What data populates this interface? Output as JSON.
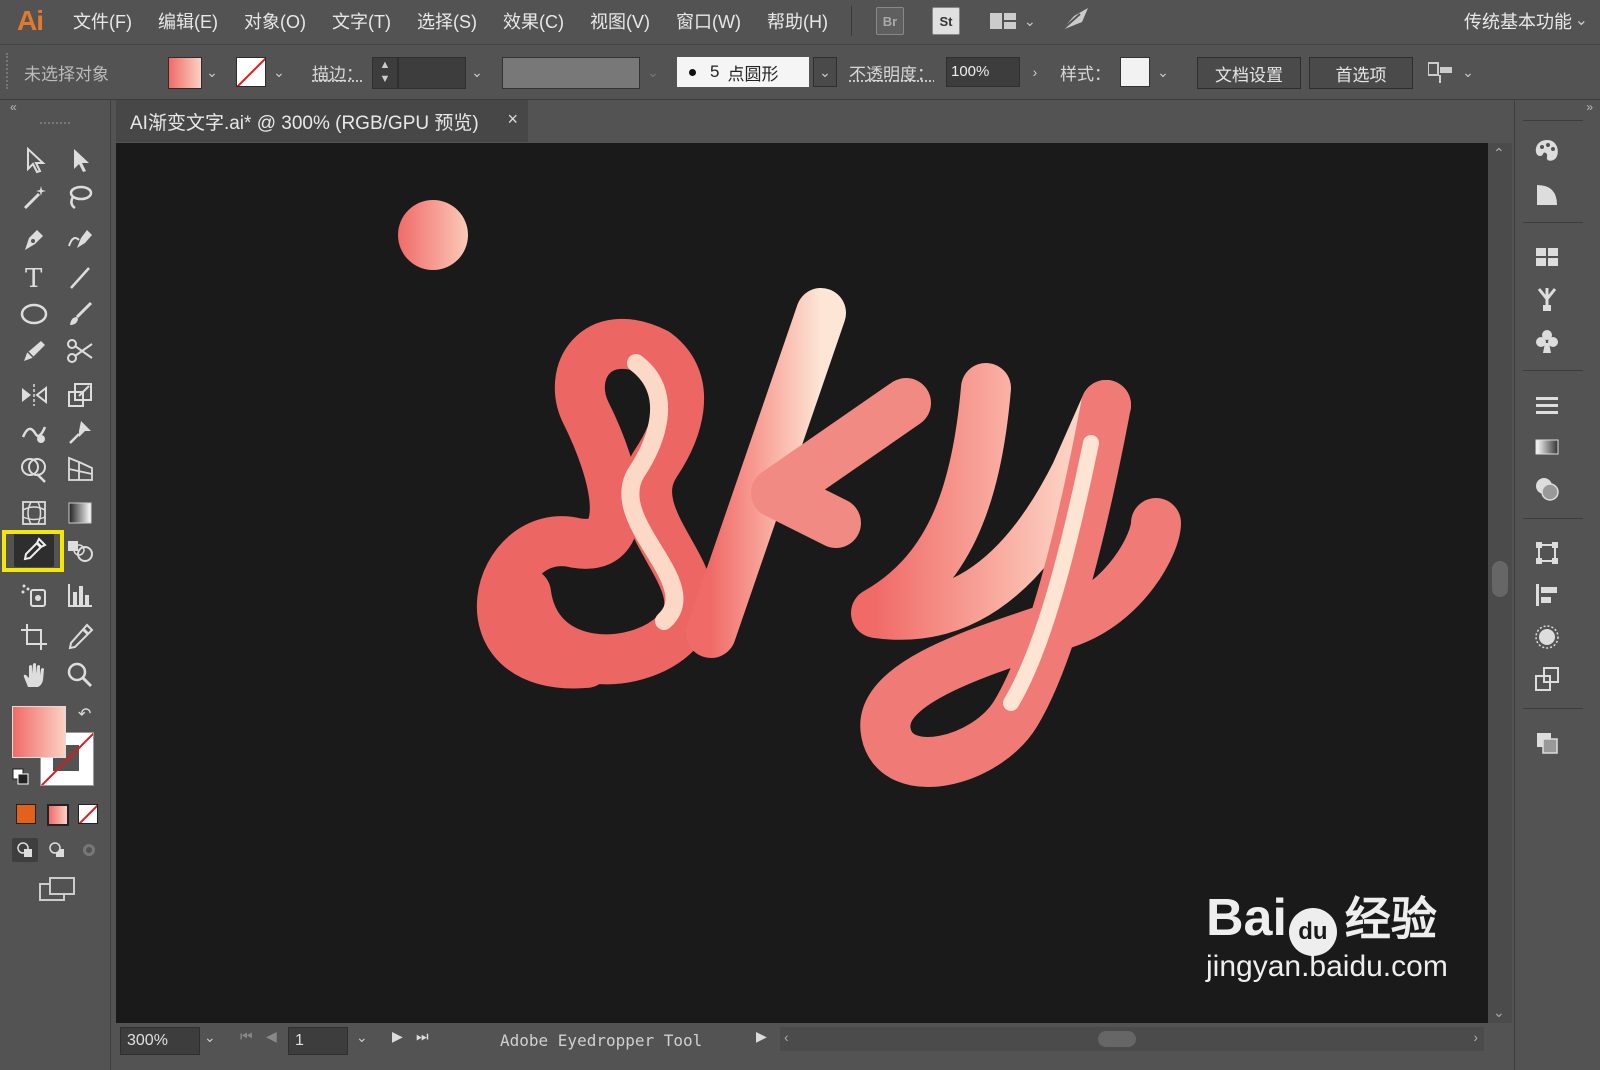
{
  "app": {
    "logo": "Ai",
    "workspace_label": "传统基本功能"
  },
  "menu": {
    "items": [
      "文件(F)",
      "编辑(E)",
      "对象(O)",
      "文字(T)",
      "选择(S)",
      "效果(C)",
      "视图(V)",
      "窗口(W)",
      "帮助(H)"
    ],
    "bridge_label": "Br",
    "stock_label": "St"
  },
  "control_bar": {
    "selection_status": "未选择对象",
    "stroke_label": "描边：",
    "brush_size": "5",
    "brush_name": "点圆形",
    "opacity_label": "不透明度：",
    "opacity_value": "100%",
    "style_label": "样式：",
    "doc_setup_button": "文档设置",
    "preferences_button": "首选项"
  },
  "document": {
    "tab_title": "AI渐变文字.ai* @ 300% (RGB/GPU 预览)",
    "tab_close": "×"
  },
  "artwork": {
    "text": "sky"
  },
  "status": {
    "zoom": "300%",
    "artboard": "1",
    "current_tool": "Adobe Eyedropper Tool"
  },
  "colors": {
    "gradient_start": "#f06b68",
    "gradient_end": "#fde6d6",
    "highlight": "#f5e800",
    "ui_bg": "#535353",
    "canvas_bg": "#1a1a1a"
  },
  "watermark": {
    "brand": "Bai",
    "brand2": "du",
    "suffix": "经验",
    "url": "jingyan.baidu.com"
  }
}
